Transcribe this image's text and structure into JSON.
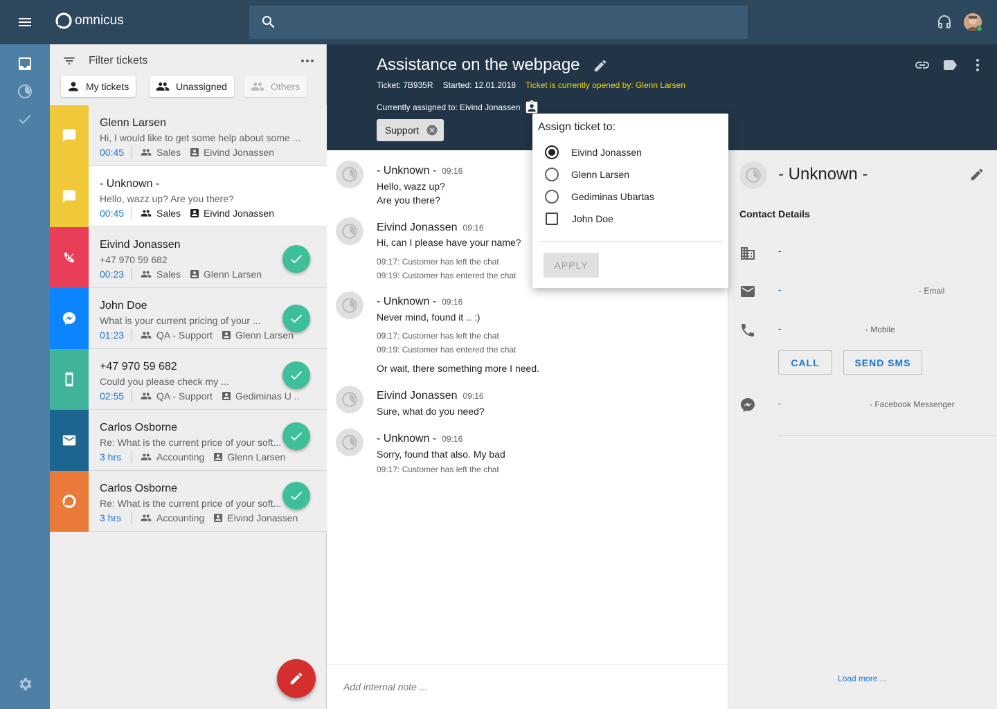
{
  "app": {
    "name": "omnicus"
  },
  "search": {
    "placeholder": ""
  },
  "filter": {
    "title": "Filter tickets",
    "buttons": [
      "My tickets",
      "Unassigned",
      "Others"
    ]
  },
  "tickets": [
    {
      "name": "Glenn Larsen",
      "snippet": "Hi, I would like to get some help about some ...",
      "time": "00:45",
      "group": "Sales",
      "agent": "Eivind Jonassen",
      "channel": "chat",
      "color": "#f0c93b",
      "done": false
    },
    {
      "name": "- Unknown -",
      "snippet": "Hello, wazz up? Are you there?",
      "time": "00:45",
      "group": "Sales",
      "agent": "Eivind Jonassen",
      "channel": "chat",
      "color": "#f0c93b",
      "done": false
    },
    {
      "name": "Eivind Jonassen",
      "snippet": "+47  970 59 682",
      "time": "00:23",
      "group": "Sales",
      "agent": "Glenn Larsen",
      "channel": "missed-call",
      "color": "#e83e58",
      "done": true
    },
    {
      "name": "John Doe",
      "snippet": "What is your current pricing of your  ...",
      "time": "01:23",
      "group": "QA - Support",
      "agent": "Glenn Larsen",
      "channel": "messenger",
      "color": "#0a84ff",
      "done": true
    },
    {
      "name": "+47 970 59 682",
      "snippet": "Could you please check my ...",
      "time": "02:55",
      "group": "QA - Support",
      "agent": "Gediminas U ..",
      "channel": "sms",
      "color": "#3fb49a",
      "done": true
    },
    {
      "name": "Carlos Osborne",
      "snippet": "Re: What is the current price of your soft...",
      "time": "3 hrs",
      "group": "Accounting",
      "agent": "Glenn Larsen",
      "channel": "email",
      "color": "#1d6591",
      "done": true
    },
    {
      "name": "Carlos Osborne",
      "snippet": "Re: What is the current price of your soft...",
      "time": "3 hrs",
      "group": "Accounting",
      "agent": "Eivind Jonassen",
      "channel": "omnicus",
      "color": "#ea7a3a",
      "done": true
    }
  ],
  "ticket": {
    "title": "Assistance on the webpage",
    "id": "Ticket: 7B935R",
    "started": "Started: 12.01.2018",
    "opened_by": "Ticket is currently opened by: Glenn Larsen",
    "assigned": "Currently assigned to:  Eivind Jonassen",
    "tag": "Support"
  },
  "messages": [
    {
      "name": "- Unknown -",
      "time": "09:16",
      "lines": [
        "Hello, wazz up?",
        "Are you there?"
      ],
      "system": []
    },
    {
      "name": "Eivind Jonassen",
      "time": "09:16",
      "lines": [
        "Hi, can I please have your name?"
      ],
      "system": [
        "09:17: Customer has left the chat",
        "09:19: Customer has entered the chat"
      ]
    },
    {
      "name": "- Unknown -",
      "time": "09:16",
      "lines": [
        "Never mind, found it .. :)"
      ],
      "system": [
        "09:17: Customer has left the chat",
        "09:19: Customer has entered the chat"
      ],
      "extra": "Or wait, there something more I need."
    },
    {
      "name": "Eivind Jonassen",
      "time": "09:16",
      "lines": [
        "Sure, what do you need?"
      ],
      "system": []
    },
    {
      "name": "- Unknown -",
      "time": "09:16",
      "lines": [
        "Sorry, found that also. My bad"
      ],
      "system": [
        "09:17: Customer has left the chat"
      ]
    }
  ],
  "note": {
    "placeholder": "Add internal note ..."
  },
  "contact": {
    "name": "- Unknown -",
    "section": "Contact Details",
    "company": "-",
    "email": "-",
    "email_type": "- Email",
    "phone": "-",
    "phone_type": "- Mobile",
    "call_label": "CALL",
    "sms_label": "SEND SMS",
    "messenger": "-",
    "messenger_type": "- Facebook Messenger",
    "load_more": "Load more ..."
  },
  "assign": {
    "title": "Assign ticket to:",
    "options": [
      "Eivind Jonassen",
      "Glenn Larsen",
      "Gediminas Ubartas",
      "John Doe"
    ],
    "selected": "Eivind Jonassen",
    "apply_label": "APPLY"
  }
}
